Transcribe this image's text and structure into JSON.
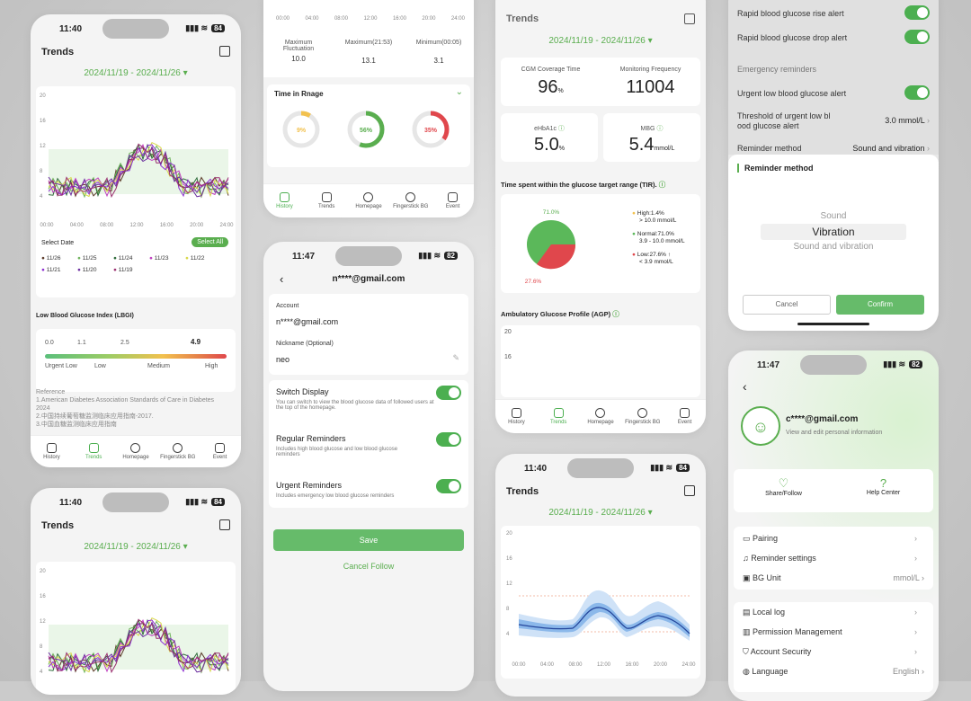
{
  "status": {
    "time1": "11:40",
    "time2": "11:47",
    "battery1": "84",
    "battery2": "82"
  },
  "trends": {
    "title": "Trends",
    "date_range": "2024/11/19 - 2024/11/26 ▾",
    "y_ticks": [
      "20",
      "16",
      "12",
      "8",
      "4"
    ],
    "x_ticks": [
      "00:00",
      "04:00",
      "08:00",
      "12:00",
      "16:00",
      "20:00",
      "24:00"
    ],
    "select_date": "Select Date",
    "select_all": "Select All",
    "dates": [
      "11/26",
      "11/25",
      "11/24",
      "11/23",
      "11/22",
      "11/21",
      "11/20",
      "11/19"
    ],
    "lbgi_title": "Low Blood Glucose Index (LBGI)",
    "lbgi_ticks": [
      "0.0",
      "1.1",
      "2.5",
      "4.9"
    ],
    "lbgi_levels": [
      "Urgent Low",
      "Low",
      "Medium",
      "High"
    ],
    "reference": [
      "Reference",
      "1.American Diabetes Association Standards of Care in Diabetes 2024",
      "2.中国持续葡萄糖监测临床应用指南-2017.",
      "3.中国血糖监测临床应用指南"
    ]
  },
  "tabs": [
    "History",
    "Trends",
    "Homepage",
    "Fingerstick BG",
    "Event"
  ],
  "history": {
    "max_fluct_label": "Maximum Fluctuation",
    "max_fluct": "10.0",
    "max_label": "Maximum(21:53)",
    "max": "13.1",
    "min_label": "Minimum(00:05)",
    "min": "3.1",
    "tir_title": "Time in Rnage",
    "tir_values": [
      "9%",
      "56%",
      "35%"
    ],
    "x_ticks": [
      "00:00",
      "04:00",
      "08:00",
      "12:00",
      "16:00",
      "20:00",
      "24:00"
    ]
  },
  "follow": {
    "email": "n****@gmail.com",
    "account_label": "Account",
    "account": "n****@gmail.com",
    "nickname_label": "Nickname (Optional)",
    "nickname": "neo",
    "switch_title": "Switch Display",
    "switch_desc": "You can switch to view the blood glucose data of followed users at the top of the homepage.",
    "regular_title": "Regular Reminders",
    "regular_desc": "Includes high blood glucose and low blood glucose reminders",
    "urgent_title": "Urgent Reminders",
    "urgent_desc": "Includes emergency low blood glucose reminders",
    "save": "Save",
    "cancel_follow": "Cancel Follow"
  },
  "report": {
    "title": "Trends",
    "date_range": "2024/11/19 - 2024/11/26 ▾",
    "coverage_label": "CGM Coverage Time",
    "coverage": "96",
    "coverage_unit": "%",
    "freq_label": "Monitoring Frequency",
    "freq": "11004",
    "ehba1c_label": "eHbA1c",
    "ehba1c": "5.0",
    "ehba1c_unit": "%",
    "mbg_label": "MBG",
    "mbg": "5.4",
    "mbg_unit": "mmol/L",
    "tir_title": "Time spent within the glucose target range (TIR).",
    "pie_top": "71.0%",
    "pie_low": "27.6%",
    "high": "High:1.4%",
    "high_range": "> 10.0 mmol/L",
    "normal": "Normal:71.0%",
    "normal_range": "3.9 - 10.0 mmol/L",
    "low": "Low:27.6% ↑",
    "low_range": "< 3.9 mmol/L",
    "agp_title": "Ambulatory Glucose Profile (AGP)",
    "agp_y": [
      "20",
      "16"
    ]
  },
  "agp": {
    "time": "11:40",
    "battery": "84",
    "title": "Trends",
    "date_range": "2024/11/19 - 2024/11/26 ▾",
    "y_ticks": [
      "20",
      "16",
      "12",
      "8",
      "4"
    ],
    "x_ticks": [
      "00:00",
      "04:00",
      "08:00",
      "12:00",
      "16:00",
      "20:00",
      "24:00"
    ]
  },
  "settings": {
    "rise": "Rapid blood glucose rise alert",
    "drop": "Rapid blood glucose drop alert",
    "emergency": "Emergency reminders",
    "urgent_low": "Urgent low blood glucose alert",
    "threshold": "Threshold of urgent low bl ood glucose alert",
    "threshold_val": "3.0 mmol/L",
    "method": "Reminder method",
    "method_val": "Sound and vibration",
    "sheet_title": "Reminder method",
    "options": [
      "Sound",
      "Vibration",
      "Sound and vibration"
    ],
    "cancel": "Cancel",
    "confirm": "Confirm"
  },
  "profile": {
    "email": "c****@gmail.com",
    "sub": "View and edit personal information",
    "share": "Share/Follow",
    "help": "Help Center",
    "items": [
      "Pairing",
      "Reminder settings",
      "BG Unit",
      "Local log",
      "Permission Management",
      "Account Security",
      "Language"
    ],
    "bg_unit": "mmol/L",
    "language": "English"
  },
  "colors": {
    "accent": "#5aae4f",
    "low": "#e0474c",
    "high": "#f2c14e"
  }
}
